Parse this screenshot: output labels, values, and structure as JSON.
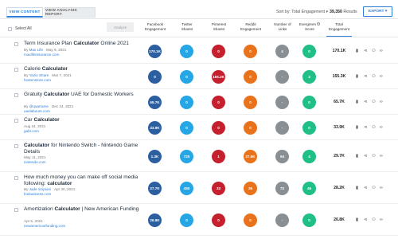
{
  "tabs": [
    {
      "label": "VIEW CONTENT"
    },
    {
      "label": "VIEW ANALYSIS REPORT"
    }
  ],
  "sort": {
    "label": "Sort by: Total Engagement ▾"
  },
  "results": {
    "count": "39,350",
    "label": "Results"
  },
  "export": {
    "label": "EXPORT ▾"
  },
  "toolbar": {
    "select_all": "Select All",
    "analyze": "Analyze"
  },
  "columns": [
    {
      "line1": "Facebook",
      "line2": "Engagement"
    },
    {
      "line1": "Twitter",
      "line2": "Shares"
    },
    {
      "line1": "Pinterest",
      "line2": "Shares"
    },
    {
      "line1": "Reddit",
      "line2": "Engagement"
    },
    {
      "line1": "Number of",
      "line2": "Links"
    },
    {
      "line1": "Evergreen",
      "line2": "Score"
    },
    {
      "line1": "Total",
      "line2": "Engagement"
    }
  ],
  "rows": [
    {
      "title_pre": "Term Insurance Plan ",
      "title_bold": "Calculator",
      "title_post": " Online 2021",
      "byline": "By ",
      "author": "Max Life",
      "date": "May 8, 2021",
      "url": "maxlifeinsurance.com",
      "metrics": [
        "170.1K",
        "0",
        "0",
        "0",
        "4",
        "0"
      ],
      "colors": [
        "blue",
        "cyan",
        "red",
        "orange",
        "gray",
        "green"
      ],
      "total": "170.1K"
    },
    {
      "title_pre": "Calorie ",
      "title_bold": "Calculator",
      "title_post": "",
      "byline": "By ",
      "author": "Yazio Share",
      "date": "Mar 7, 2021",
      "url": "hostenstore.com",
      "metrics": [
        "0",
        "0",
        "155.3K",
        "0",
        "-",
        "3"
      ],
      "colors": [
        "blue",
        "cyan",
        "red",
        "orange",
        "gray",
        "green"
      ],
      "total": "155.3K"
    },
    {
      "title_pre": "Gratuity ",
      "title_bold": "Calculator",
      "title_post": " UAE for Domestic Workers",
      "byline": "By ",
      "author": "@quarrame",
      "date": "Dec 24, 2021",
      "url": "uaelabours.com",
      "metrics": [
        "65.7K",
        "0",
        "0",
        "0",
        "-",
        "0"
      ],
      "colors": [
        "blue",
        "cyan",
        "red",
        "orange",
        "gray",
        "green"
      ],
      "total": "65.7K"
    },
    {
      "title_pre": "Car ",
      "title_bold": "Calculator",
      "title_post": "",
      "byline": "",
      "author": "",
      "date": "Aug 24, 2021",
      "url": "gabr.com",
      "metrics": [
        "33.9K",
        "0",
        "0",
        "0",
        "-",
        "0"
      ],
      "colors": [
        "blue",
        "cyan",
        "red",
        "orange",
        "gray",
        "green"
      ],
      "total": "33.9K"
    },
    {
      "title_pre": "",
      "title_bold": "Calculator",
      "title_post": " for Nintendo Switch - Nintendo Game Details",
      "byline": "",
      "author": "",
      "date": "May 11, 2021",
      "url": "nintendo.com",
      "metrics": [
        "1.3K",
        "720",
        "1",
        "27.6K",
        "94",
        "4"
      ],
      "colors": [
        "blue",
        "cyan",
        "red",
        "orange",
        "gray",
        "green"
      ],
      "total": "29.7K"
    },
    {
      "title_pre": "How much money you can make off social media following: ",
      "title_bold": "calculator",
      "title_post": "",
      "byline": "By ",
      "author": "Jade Scipioni",
      "date": "Apr 30, 2021",
      "url": "foxbusiness.com",
      "metrics": [
        "27.7K",
        "450",
        "33",
        "36",
        "72",
        "46"
      ],
      "colors": [
        "blue",
        "cyan",
        "red",
        "orange",
        "gray",
        "green"
      ],
      "total": "28.2K"
    },
    {
      "title_pre": "Amortization ",
      "title_bold": "Calculator",
      "title_post": " | New American Funding",
      "byline": "",
      "author": "",
      "date": "Apr 5, 2021",
      "url": "newamericanfunding.com",
      "metrics": [
        "26.8K",
        "0",
        "0",
        "0",
        "-",
        "0"
      ],
      "colors": [
        "blue",
        "cyan",
        "red",
        "orange",
        "gray",
        "green"
      ],
      "total": "26.8K"
    }
  ],
  "row_actions": [
    "bookmark-icon",
    "share-icon",
    "users-icon",
    "link-icon"
  ]
}
